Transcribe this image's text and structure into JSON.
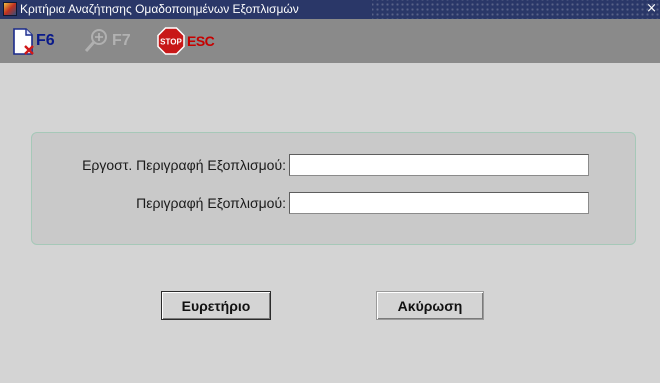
{
  "window": {
    "title": "Κριτήρια Αναζήτησης Ομαδοποιημένων Εξοπλισμών",
    "close_glyph": "×",
    "app_icon": "forms-app-icon"
  },
  "toolbar": {
    "f6": {
      "label": "F6",
      "icon": "new-document-icon"
    },
    "f7": {
      "label": "F7",
      "icon": "search-magnifier-icon",
      "enabled": false
    },
    "esc": {
      "stop_text": "STOP",
      "label": "ESC",
      "icon": "stop-sign-icon"
    }
  },
  "form": {
    "manufacturer_description": {
      "label": "Εργοστ. Περιγραφή Εξοπλισμού:",
      "value": ""
    },
    "description": {
      "label": "Περιγραφή Εξοπλισμού:",
      "value": ""
    }
  },
  "buttons": {
    "index": "Ευρετήριο",
    "cancel": "Ακύρωση"
  },
  "colors": {
    "title_bar": "#2a3768",
    "toolbar": "#8a8a8a",
    "background": "#d4d4d4",
    "panel_border": "#a6c8b8",
    "f6_label": "#0a1a8a",
    "esc_label": "#c60000"
  }
}
